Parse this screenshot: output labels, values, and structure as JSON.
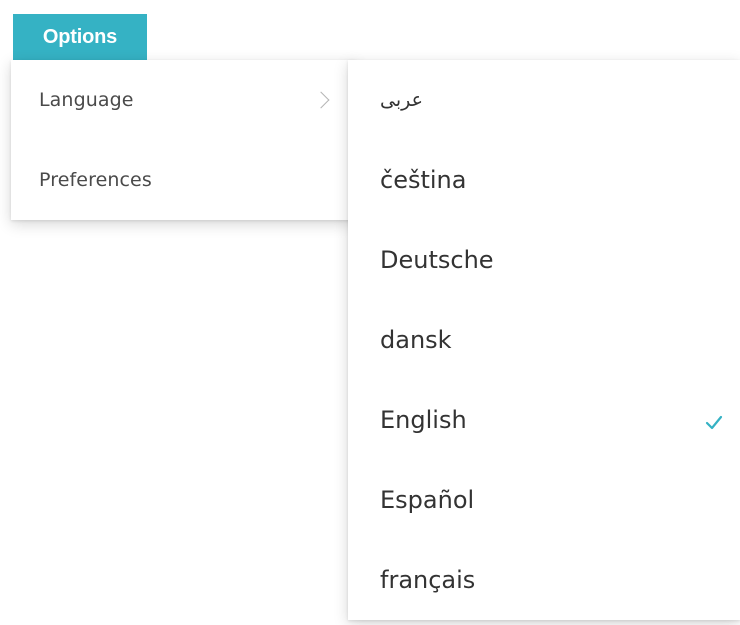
{
  "options_button": {
    "label": "Options"
  },
  "menu": {
    "items": [
      {
        "label": "Language",
        "has_submenu": true,
        "icon": "chevron-right-icon"
      },
      {
        "label": "Preferences",
        "has_submenu": false
      }
    ]
  },
  "language_submenu": {
    "items": [
      {
        "label": "عربى",
        "selected": false
      },
      {
        "label": "čeština",
        "selected": false
      },
      {
        "label": "Deutsche",
        "selected": false
      },
      {
        "label": "dansk",
        "selected": false
      },
      {
        "label": "English",
        "selected": true,
        "icon": "checkmark-icon"
      },
      {
        "label": "Español",
        "selected": false
      },
      {
        "label": "français",
        "selected": false
      }
    ]
  },
  "colors": {
    "accent": "#35b2c4",
    "menu_text": "#4a4a4a",
    "submenu_text": "#333333",
    "chevron": "#b5b5b5"
  }
}
